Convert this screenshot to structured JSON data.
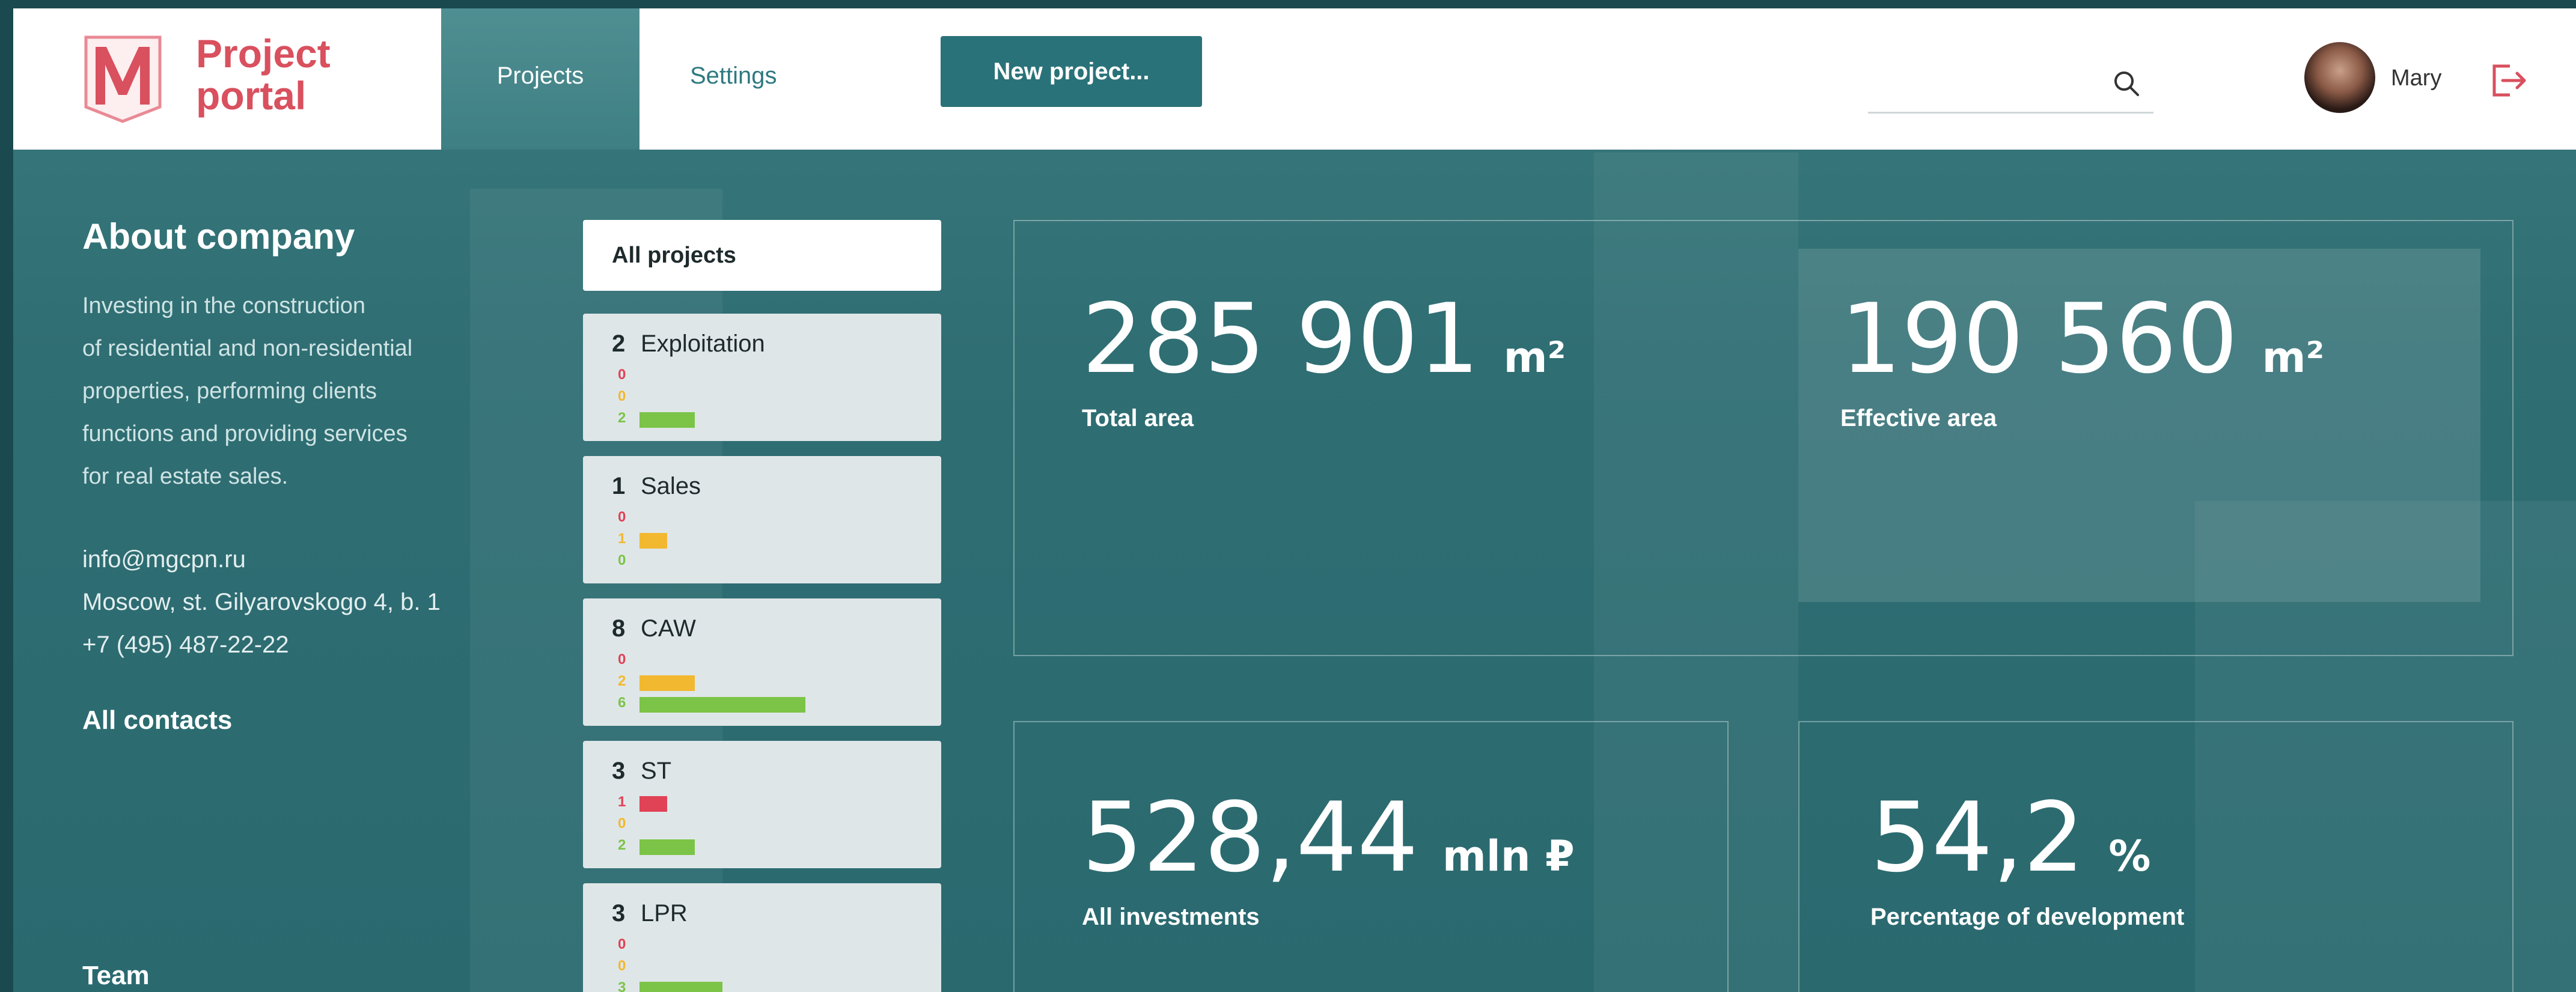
{
  "header": {
    "logo_line1": "Project",
    "logo_line2": "portal",
    "tabs": [
      {
        "label": "Projects",
        "active": true
      },
      {
        "label": "Settings",
        "active": false
      }
    ],
    "new_project_label": "New project...",
    "search_placeholder": "",
    "user_name": "Mary",
    "accent_color": "#d9505e",
    "brand_teal": "#2a7279"
  },
  "about": {
    "title": "About company",
    "description_lines": [
      "Investing in the construction",
      "of residential and non-residential",
      "properties, performing clients",
      "functions and providing services",
      "for real estate sales."
    ],
    "email": "info@mgcpn.ru",
    "address": "Moscow, st. Gilyarovskogo 4, b. 1",
    "phone": "+7 (495) 487-22-22",
    "all_contacts_label": "All contacts",
    "team_label": "Team"
  },
  "projects": {
    "all_label": "All projects",
    "status_colors": {
      "red": "#e04256",
      "yellow": "#f2b830",
      "green": "#7bc447"
    },
    "groups": [
      {
        "count": "2",
        "name": "Exploitation",
        "stats": [
          {
            "color": "red",
            "value": 0
          },
          {
            "color": "yellow",
            "value": 0
          },
          {
            "color": "green",
            "value": 2
          }
        ]
      },
      {
        "count": "1",
        "name": "Sales",
        "stats": [
          {
            "color": "red",
            "value": 0
          },
          {
            "color": "yellow",
            "value": 1
          },
          {
            "color": "green",
            "value": 0
          }
        ]
      },
      {
        "count": "8",
        "name": "CAW",
        "stats": [
          {
            "color": "red",
            "value": 0
          },
          {
            "color": "yellow",
            "value": 2
          },
          {
            "color": "green",
            "value": 6
          }
        ]
      },
      {
        "count": "3",
        "name": "ST",
        "stats": [
          {
            "color": "red",
            "value": 1
          },
          {
            "color": "yellow",
            "value": 0
          },
          {
            "color": "green",
            "value": 2
          }
        ]
      },
      {
        "count": "3",
        "name": "LPR",
        "stats": [
          {
            "color": "red",
            "value": 0
          },
          {
            "color": "yellow",
            "value": 0
          },
          {
            "color": "green",
            "value": 3
          }
        ]
      }
    ]
  },
  "stats": {
    "total_area": {
      "value": "285 901",
      "unit": "m²",
      "label": "Total area"
    },
    "effective_area": {
      "value": "190 560",
      "unit": "m²",
      "label": "Effective area"
    },
    "investments": {
      "value": "528,44",
      "unit": "mln ₽",
      "label": "All investments"
    },
    "development": {
      "value": "54,2",
      "unit": "%",
      "label": "Percentage of development"
    }
  }
}
